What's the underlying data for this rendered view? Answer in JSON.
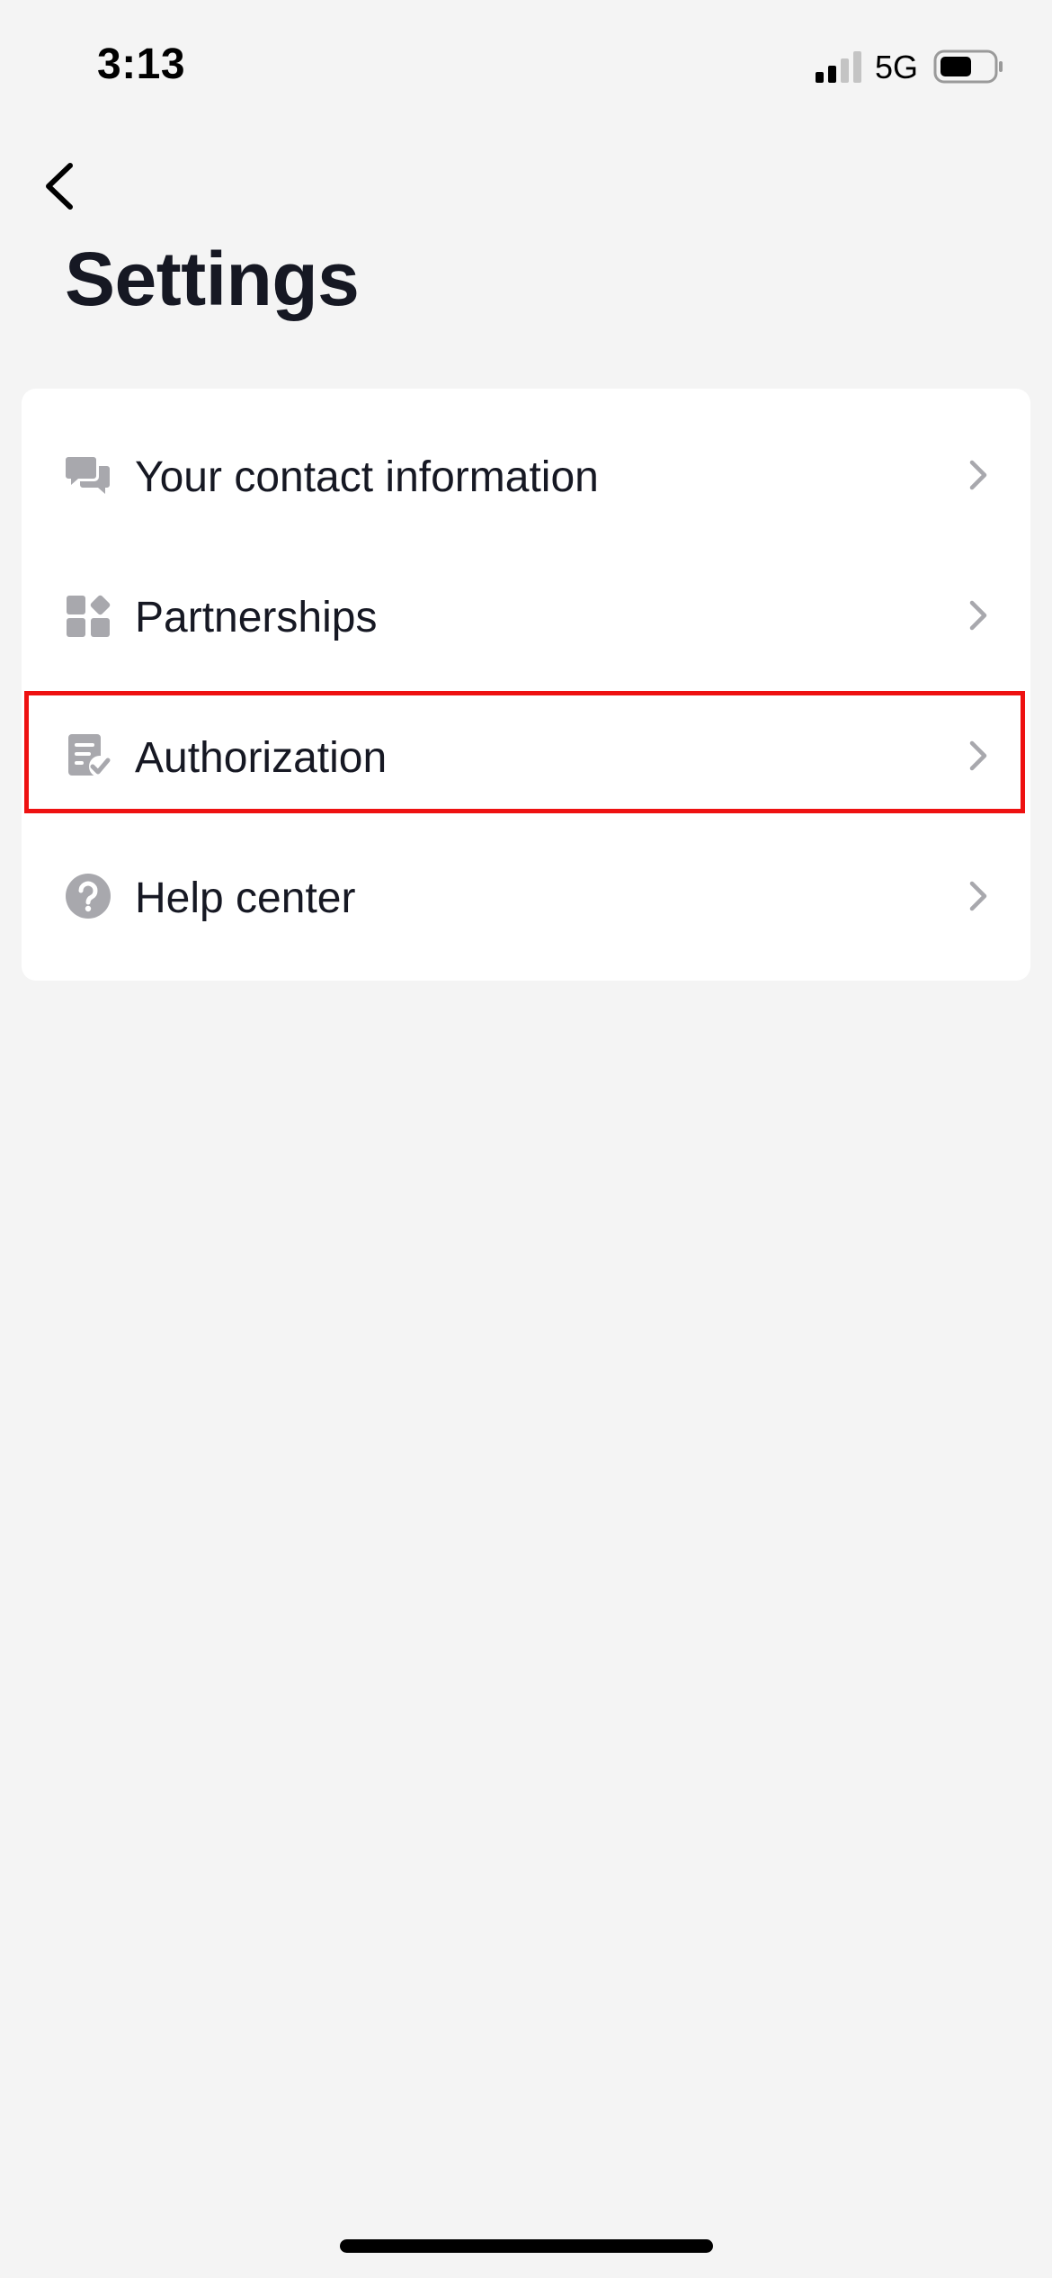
{
  "status_bar": {
    "time": "3:13",
    "network": "5G"
  },
  "header": {
    "back_icon": "chevron-left-icon",
    "title": "Settings"
  },
  "menu": {
    "items": [
      {
        "label": "Your contact information",
        "icon": "chat-bubbles-icon"
      },
      {
        "label": "Partnerships",
        "icon": "apps-grid-icon"
      },
      {
        "label": "Authorization",
        "icon": "document-check-icon"
      },
      {
        "label": "Help center",
        "icon": "help-circle-icon"
      }
    ]
  },
  "highlight": {
    "target": "Authorization",
    "color": "#ee1111"
  },
  "colors": {
    "background": "#f4f4f4",
    "card": "#ffffff",
    "icon_gray": "#a8a8ad",
    "text": "#161823"
  }
}
